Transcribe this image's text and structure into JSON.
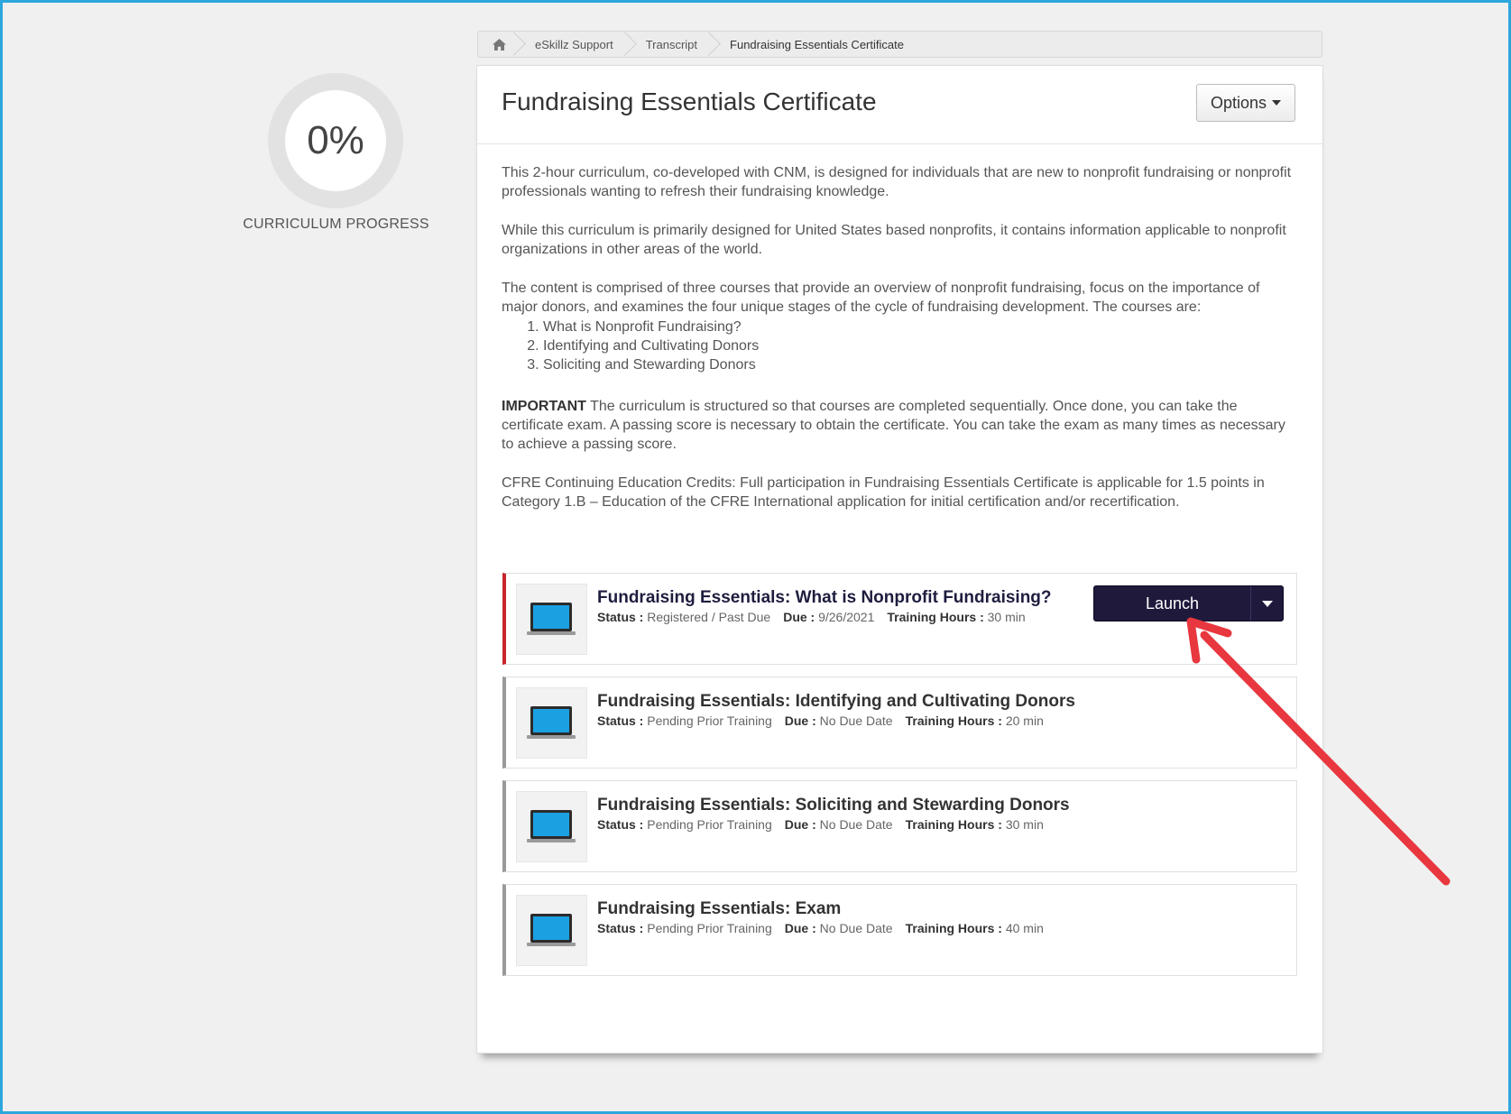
{
  "breadcrumb": {
    "items": [
      "eSkillz Support",
      "Transcript",
      "Fundraising Essentials Certificate"
    ]
  },
  "progress": {
    "value_text": "0%",
    "label": "CURRICULUM PROGRESS"
  },
  "page": {
    "title": "Fundraising Essentials Certificate",
    "options_label": "Options"
  },
  "description": {
    "p1": "This 2-hour curriculum, co-developed with CNM, is designed for individuals that are new to nonprofit fundraising or nonprofit professionals wanting to refresh their fundraising knowledge.",
    "p2": "While this curriculum is primarily designed for United States based nonprofits, it contains information applicable to nonprofit organizations in other areas of the world.",
    "p3": "The content is comprised of three courses that provide an overview of nonprofit fundraising, focus on the importance of major donors, and examines the four unique stages of the cycle of fundraising development. The courses are:",
    "courses": [
      "What is Nonprofit Fundraising?",
      "Identifying and Cultivating Donors",
      "Soliciting and Stewarding Donors"
    ],
    "important_label": "IMPORTANT",
    "important_text": " The curriculum is structured so that courses are completed sequentially. Once done, you can take the certificate exam. A passing score is necessary to obtain the certificate. You can take the exam as many times as necessary to achieve a passing score.",
    "p5": "CFRE Continuing Education Credits: Full participation in Fundraising Essentials Certificate is applicable for 1.5 points in Category 1.B – Education of the CFRE International application for initial certification and/or recertification."
  },
  "labels": {
    "status": "Status :",
    "due": "Due :",
    "hours": "Training Hours :"
  },
  "trainings": [
    {
      "title": "Fundraising Essentials: What is Nonprofit Fundraising?",
      "status": "Registered / Past Due",
      "due": "9/26/2021",
      "hours": "30 min",
      "action": "Launch"
    },
    {
      "title": "Fundraising Essentials: Identifying and Cultivating Donors",
      "status": "Pending Prior Training",
      "due": "No Due Date",
      "hours": "20 min"
    },
    {
      "title": "Fundraising Essentials: Soliciting and Stewarding Donors",
      "status": "Pending Prior Training",
      "due": "No Due Date",
      "hours": "30 min"
    },
    {
      "title": "Fundraising Essentials: Exam",
      "status": "Pending Prior Training",
      "due": "No Due Date",
      "hours": "40 min"
    }
  ],
  "colors": {
    "frame": "#2ba7dc",
    "launch_bg": "#1f1a3c",
    "past_due_bar": "#c9252b",
    "annotation_arrow": "#e8373f",
    "laptop_screen": "#1ba1e2"
  },
  "icons": [
    "home-icon",
    "laptop-icon",
    "caret-down-icon",
    "annotation-arrow"
  ]
}
